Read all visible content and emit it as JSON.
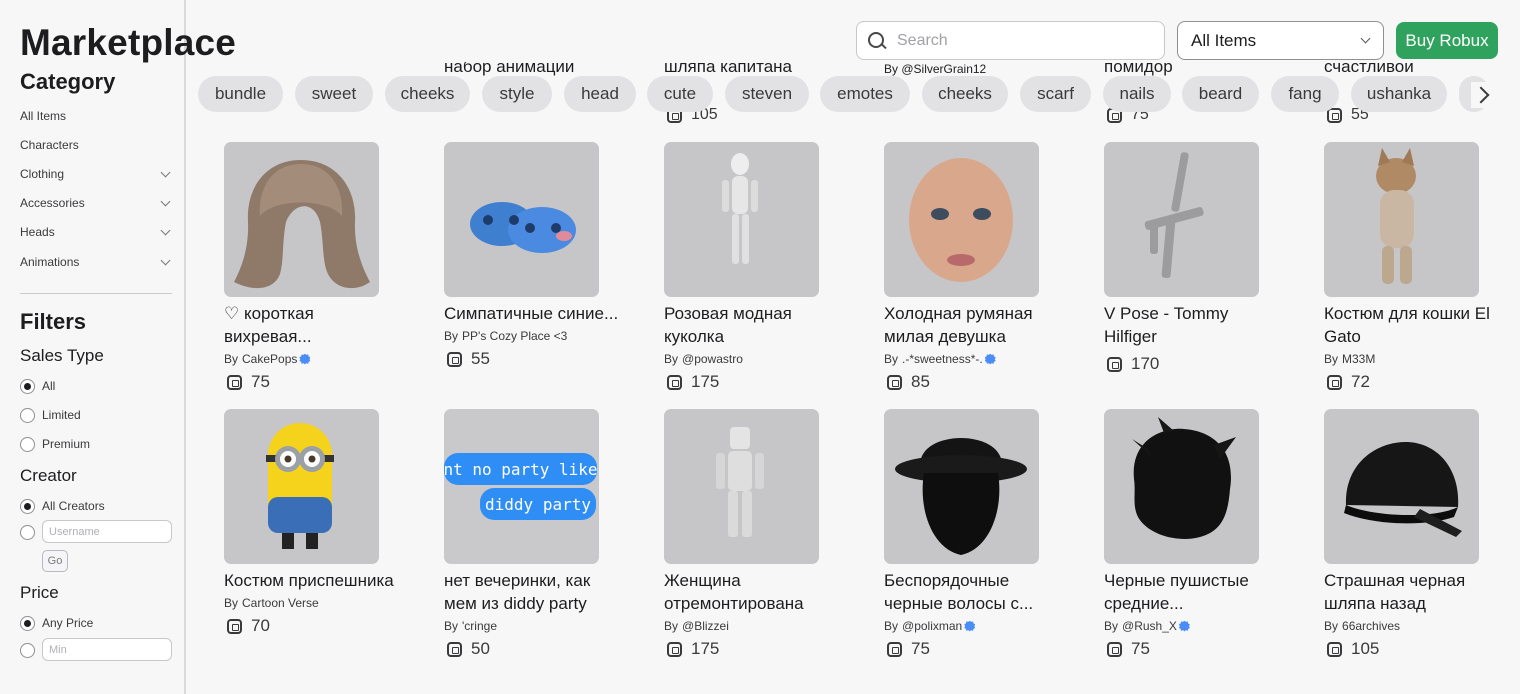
{
  "page": {
    "title": "Marketplace"
  },
  "header": {
    "search_placeholder": "Search",
    "select_value": "All Items",
    "buy_label": "Buy Robux"
  },
  "sidebar": {
    "category_title": "Category",
    "categories": [
      {
        "label": "All Items",
        "expandable": false
      },
      {
        "label": "Characters",
        "expandable": false
      },
      {
        "label": "Clothing",
        "expandable": true
      },
      {
        "label": "Accessories",
        "expandable": true
      },
      {
        "label": "Heads",
        "expandable": true
      },
      {
        "label": "Animations",
        "expandable": true
      }
    ],
    "filters_title": "Filters",
    "sales_type": {
      "title": "Sales Type",
      "options": [
        "All",
        "Limited",
        "Premium"
      ],
      "selected": "All"
    },
    "creator": {
      "title": "Creator",
      "all_label": "All Creators",
      "username_placeholder": "Username",
      "go_label": "Go"
    },
    "price": {
      "title": "Price",
      "any_label": "Any Price",
      "min_placeholder": "Min"
    }
  },
  "peek_row": {
    "names": [
      "",
      "набор анимаций",
      "шляпа капитана",
      "By @SilverGrain12",
      "помидор",
      "счастливой"
    ],
    "prices": [
      "105",
      "75",
      "55"
    ]
  },
  "chips": [
    "bundle",
    "sweet",
    "cheeks",
    "style",
    "head",
    "cute",
    "steven",
    "emotes",
    "cheeks",
    "scarf",
    "nails",
    "beard",
    "fang",
    "ushanka"
  ],
  "items": [
    {
      "name": "♡ короткая вихревая...",
      "by": "By",
      "creator": "CakePops",
      "verified": true,
      "price": "75",
      "thumb": "wig"
    },
    {
      "name": "Симпатичные синие...",
      "by": "By",
      "creator": "PP's Cozy Place <3",
      "verified": false,
      "price": "55",
      "thumb": "slippers"
    },
    {
      "name": "Розовая модная куколка",
      "by": "By",
      "creator": "@powastro",
      "verified": false,
      "price": "175",
      "thumb": "figure"
    },
    {
      "name": "Холодная румяная милая девушка",
      "by": "By",
      "creator": ".-*sweetness*-.",
      "verified": true,
      "price": "85",
      "thumb": "face"
    },
    {
      "name": "V Pose - Tommy Hilfiger",
      "by": "",
      "creator": "",
      "verified": false,
      "price": "170",
      "thumb": "pose"
    },
    {
      "name": "Костюм для кошки El Gato",
      "by": "By",
      "creator": "M33M",
      "verified": false,
      "price": "72",
      "thumb": "cat"
    },
    {
      "name": "Костюм приспешника",
      "by": "By",
      "creator": "Cartoon Verse",
      "verified": false,
      "price": "70",
      "thumb": "minion"
    },
    {
      "name": "нет вечеринки, как мем из diddy party",
      "by": "By",
      "creator": "'cringe",
      "verified": false,
      "price": "50",
      "thumb": "bubbles",
      "bubble1": "aint no party like a",
      "bubble2": "diddy party"
    },
    {
      "name": "Женщина отремонтирована",
      "by": "By",
      "creator": "@Blizzei",
      "verified": false,
      "price": "175",
      "thumb": "figure2"
    },
    {
      "name": "Беспорядочные черные волосы с...",
      "by": "By",
      "creator": "@polixman",
      "verified": true,
      "price": "75",
      "thumb": "hat"
    },
    {
      "name": "Черные пушистые средние...",
      "by": "By",
      "creator": "@Rush_X",
      "verified": true,
      "price": "75",
      "thumb": "hair"
    },
    {
      "name": "Страшная черная шляпа назад",
      "by": "By",
      "creator": "66archives",
      "verified": false,
      "price": "105",
      "thumb": "cap"
    }
  ]
}
